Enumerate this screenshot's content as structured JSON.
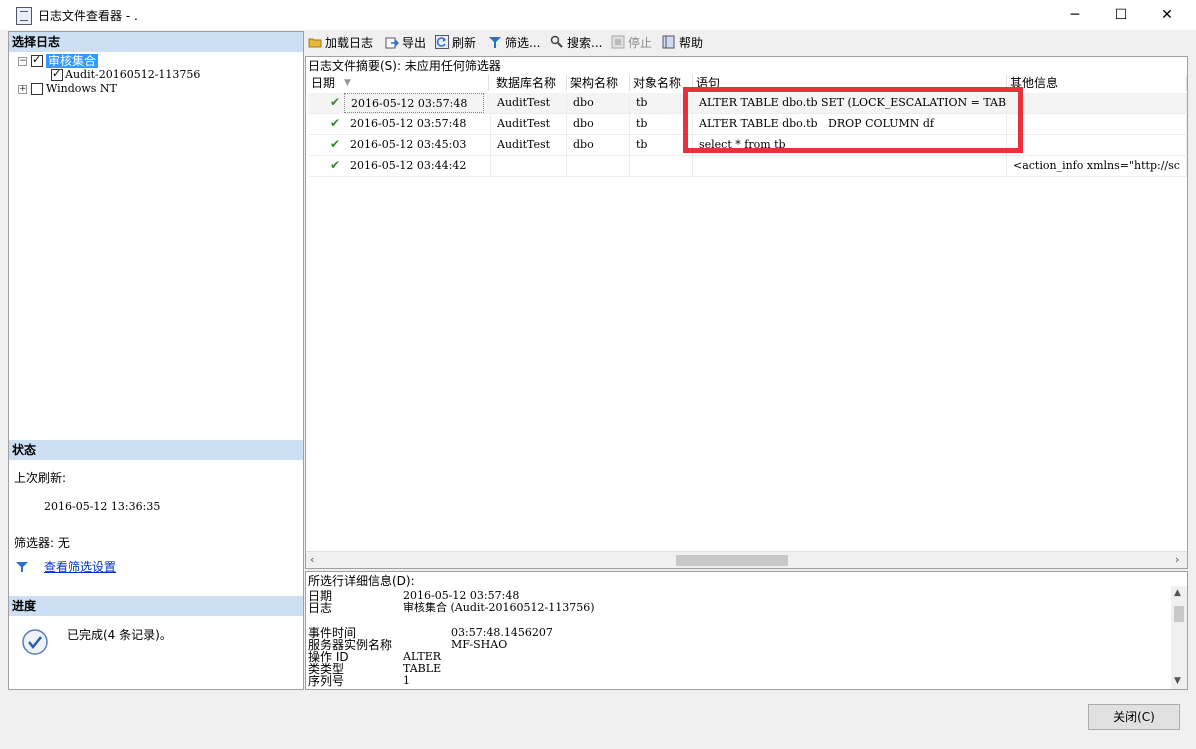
{
  "window": {
    "title": "日志文件查看器 - .",
    "minimize": "─",
    "maximize": "☐",
    "close": "✕"
  },
  "left": {
    "select_header": "选择日志",
    "tree": [
      {
        "label": "审核集合",
        "checked": true,
        "expander": "−"
      },
      {
        "label": "Audit-20160512-113756",
        "checked": true
      },
      {
        "label": "Windows NT",
        "checked": false,
        "expander": "+"
      }
    ],
    "status_header": "状态",
    "last_refresh_label": "上次刷新:",
    "last_refresh_value": "2016-05-12 13:36:35",
    "filter_label": "筛选器: 无",
    "filter_link": "查看筛选设置",
    "progress_header": "进度",
    "progress_text": "已完成(4 条记录)。"
  },
  "toolbar": {
    "load": "加载日志",
    "export": "导出",
    "refresh": "刷新",
    "filter": "筛选...",
    "search": "搜索...",
    "stop": "停止",
    "help": "帮助"
  },
  "grid": {
    "summary": "日志文件摘要(S): 未应用任何筛选器",
    "columns": [
      "日期",
      "数据库名称",
      "架构名称",
      "对象名称",
      "语句",
      "其他信息"
    ],
    "rows": [
      {
        "date": "2016-05-12 03:57:48",
        "db": "AuditTest",
        "schema": "dbo",
        "object": "tb",
        "statement": "ALTER TABLE dbo.tb SET (LOCK_ESCALATION = TABLE)",
        "info": ""
      },
      {
        "date": "2016-05-12 03:57:48",
        "db": "AuditTest",
        "schema": "dbo",
        "object": "tb",
        "statement": "ALTER TABLE dbo.tb   DROP COLUMN df",
        "info": ""
      },
      {
        "date": "2016-05-12 03:45:03",
        "db": "AuditTest",
        "schema": "dbo",
        "object": "tb",
        "statement": "select * from tb",
        "info": ""
      },
      {
        "date": "2016-05-12 03:44:42",
        "db": "",
        "schema": "",
        "object": "",
        "statement": "",
        "info": "<action_info xmlns=\"http://sc"
      }
    ]
  },
  "details": {
    "title": "所选行详细信息(D):",
    "items": [
      {
        "label": "日期",
        "value": "2016-05-12 03:57:48"
      },
      {
        "label": "日志",
        "value": "审核集合 (Audit-20160512-113756)"
      },
      {
        "label": "事件时间",
        "value": "03:57:48.1456207"
      },
      {
        "label": "服务器实例名称",
        "value": "MF-SHAO"
      },
      {
        "label": "操作 ID",
        "value": "ALTER"
      },
      {
        "label": "类类型",
        "value": "TABLE"
      },
      {
        "label": "序列号",
        "value": "1"
      }
    ]
  },
  "footer": {
    "close_button": "关闭(C)"
  },
  "colors": {
    "panel_header": "#cddff2",
    "highlight": "#e8323a",
    "selection": "#3399ff"
  }
}
